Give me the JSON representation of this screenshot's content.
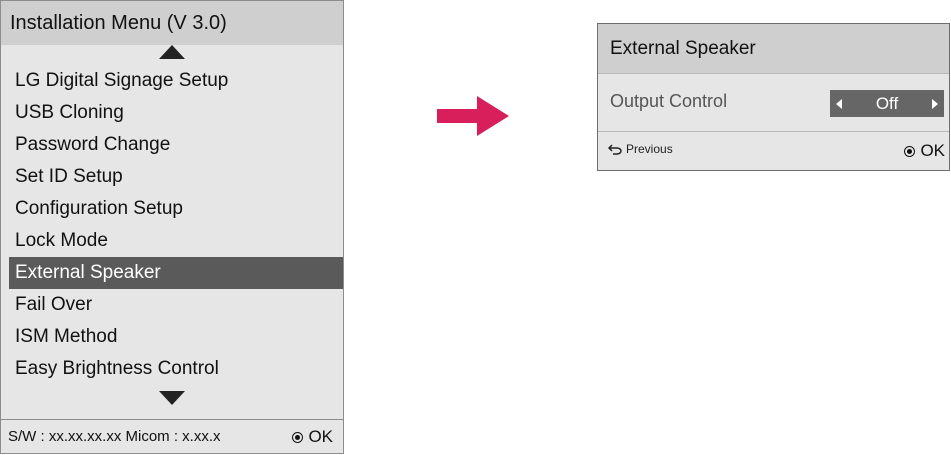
{
  "menu": {
    "title": "Installation Menu (V 3.0)",
    "items": [
      {
        "label": "LG Digital Signage Setup"
      },
      {
        "label": "USB Cloning"
      },
      {
        "label": "Password Change"
      },
      {
        "label": "Set ID Setup"
      },
      {
        "label": "Configuration Setup"
      },
      {
        "label": "Lock Mode"
      },
      {
        "label": "External Speaker",
        "selected": true
      },
      {
        "label": "Fail Over"
      },
      {
        "label": "ISM Method"
      },
      {
        "label": "Easy Brightness Control"
      }
    ],
    "footer": {
      "sw_info": "S/W : xx.xx.xx.xx Micom : x.xx.x",
      "ok_label": "OK"
    }
  },
  "dialog": {
    "title": "External Speaker",
    "setting_label": "Output Control",
    "setting_value": "Off",
    "previous_label": "Previous",
    "ok_label": "OK"
  },
  "colors": {
    "highlight": "#5a5a5a",
    "arrow": "#d81e5b",
    "panel_bg": "#e6e6e6",
    "title_bg": "#cfcfcf"
  },
  "icons": [
    "triangle-up-icon",
    "triangle-down-icon",
    "ok-circle-icon",
    "arrow-right-icon",
    "chevron-left-icon",
    "chevron-right-icon",
    "return-icon"
  ]
}
